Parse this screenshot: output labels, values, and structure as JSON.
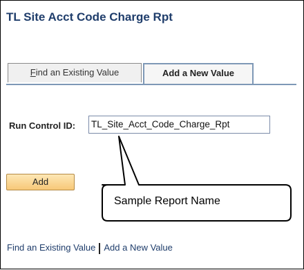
{
  "page_title": "TL Site Acct Code Charge Rpt",
  "tabs": [
    {
      "label_prefix": "F",
      "label_rest": "ind an Existing Value"
    },
    {
      "label": "Add a New Value"
    }
  ],
  "form": {
    "run_control_label": "Run Control ID:",
    "run_control_value": "TL_Site_Acct_Code_Charge_Rpt"
  },
  "add_button": "Add",
  "callout": "Sample Report Name",
  "bottom_links": {
    "find": "Find an Existing Value",
    "add": "Add a New Value"
  }
}
